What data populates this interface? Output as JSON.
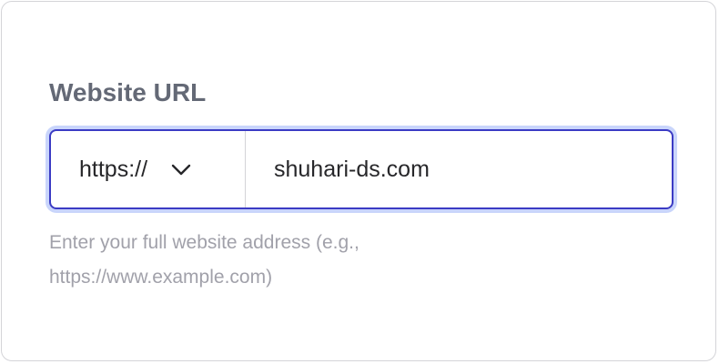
{
  "field": {
    "label": "Website URL",
    "protocol": {
      "selected": "https://",
      "icon": "chevron-down-icon"
    },
    "url_value": "shuhari-ds.com",
    "helper_text": "Enter your full website address (e.g., https://www.example.com)"
  },
  "colors": {
    "label": "#646976",
    "focus_border": "#3b3bc4",
    "focus_ring": "#c9d5fb",
    "input_text": "#27272a",
    "helper_text": "#a1a1aa",
    "divider": "#d4d4d8"
  }
}
